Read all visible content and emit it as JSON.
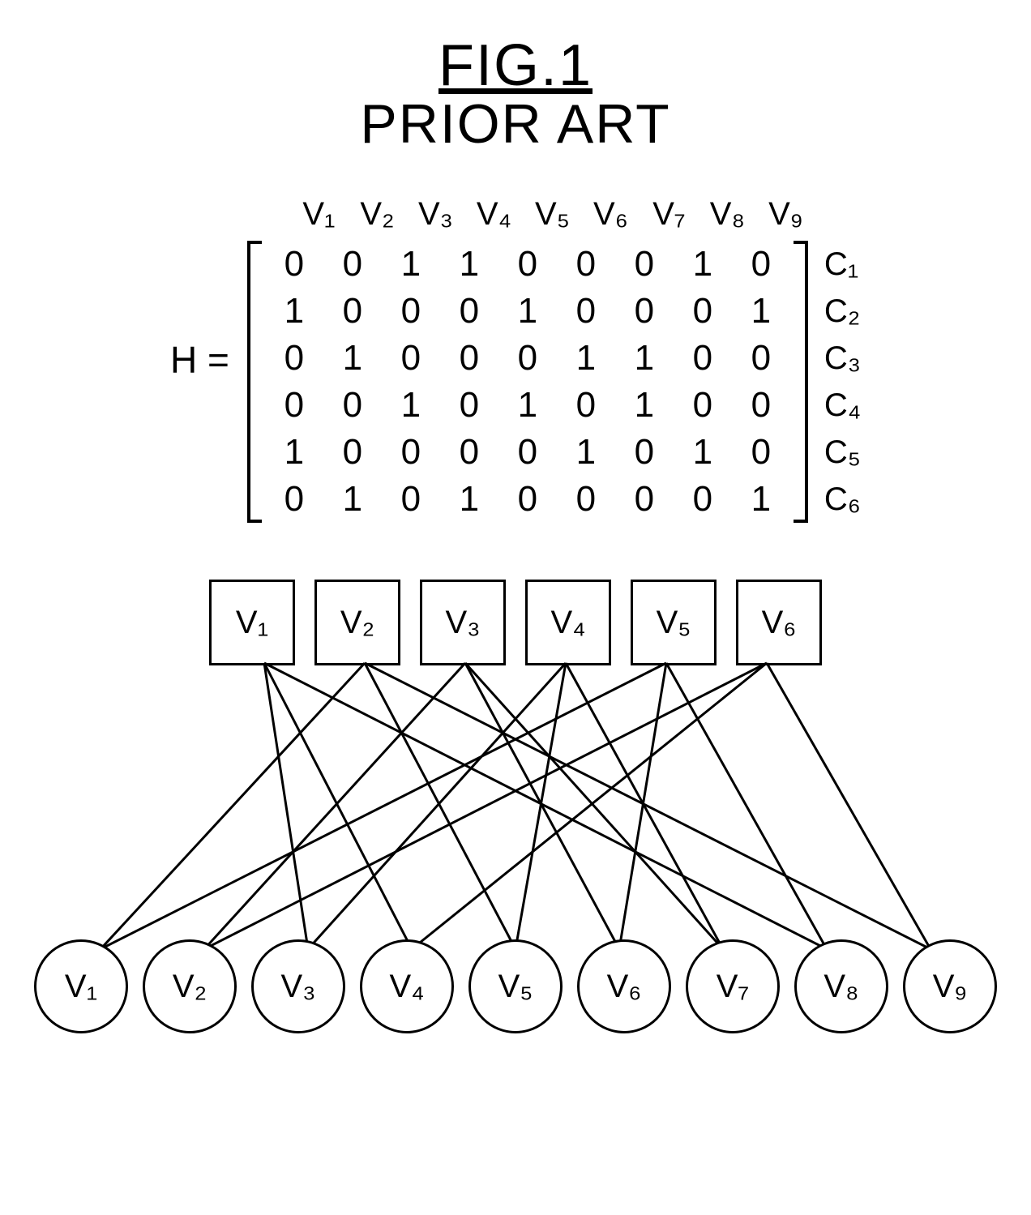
{
  "title": "FIG.1",
  "subtitle": "PRIOR ART",
  "lhs": "H =",
  "col_labels": [
    "V₁",
    "V₂",
    "V₃",
    "V₄",
    "V₅",
    "V₆",
    "V₇",
    "V₈",
    "V₉"
  ],
  "row_labels": [
    "C₁",
    "C₂",
    "C₃",
    "C₄",
    "C₅",
    "C₆"
  ],
  "matrix": [
    [
      0,
      0,
      1,
      1,
      0,
      0,
      0,
      1,
      0
    ],
    [
      1,
      0,
      0,
      0,
      1,
      0,
      0,
      0,
      1
    ],
    [
      0,
      1,
      0,
      0,
      0,
      1,
      1,
      0,
      0
    ],
    [
      0,
      0,
      1,
      0,
      1,
      0,
      1,
      0,
      0
    ],
    [
      1,
      0,
      0,
      0,
      0,
      1,
      0,
      1,
      0
    ],
    [
      0,
      1,
      0,
      1,
      0,
      0,
      0,
      0,
      1
    ]
  ],
  "top_nodes": [
    "V₁",
    "V₂",
    "V₃",
    "V₄",
    "V₅",
    "V₆"
  ],
  "bottom_nodes": [
    "V₁",
    "V₂",
    "V₃",
    "V₄",
    "V₅",
    "V₆",
    "V₇",
    "V₈",
    "V₉"
  ],
  "edges": [
    [
      1,
      3
    ],
    [
      1,
      4
    ],
    [
      1,
      8
    ],
    [
      2,
      1
    ],
    [
      2,
      5
    ],
    [
      2,
      9
    ],
    [
      3,
      2
    ],
    [
      3,
      6
    ],
    [
      3,
      7
    ],
    [
      4,
      3
    ],
    [
      4,
      5
    ],
    [
      4,
      7
    ],
    [
      5,
      1
    ],
    [
      5,
      6
    ],
    [
      5,
      8
    ],
    [
      6,
      2
    ],
    [
      6,
      4
    ],
    [
      6,
      9
    ]
  ]
}
